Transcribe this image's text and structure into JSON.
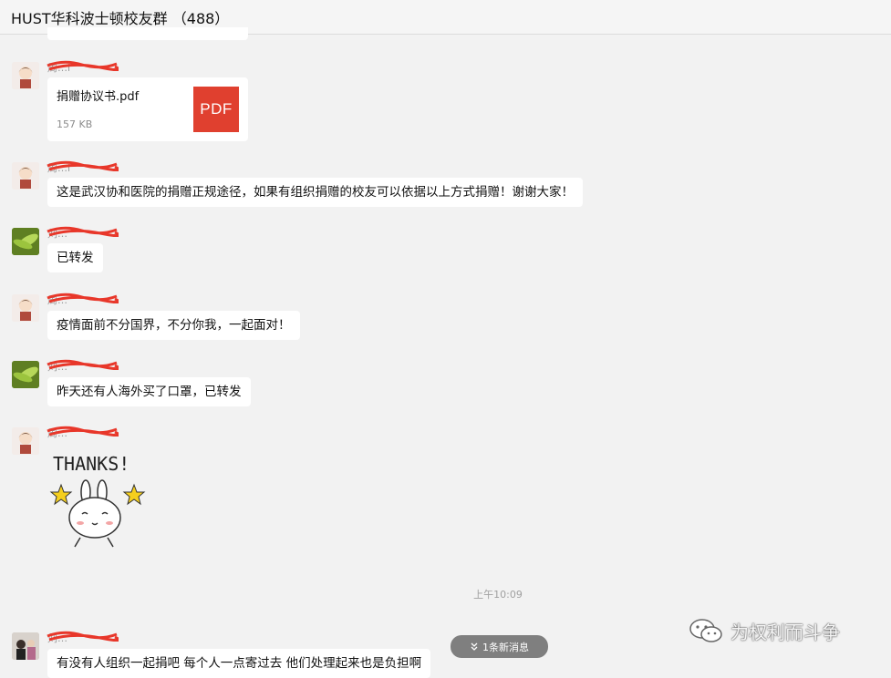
{
  "header": {
    "title": "HUST华科波士顿校友群 （488）"
  },
  "messages": [
    {
      "sender": "周…i",
      "file_name": "捐赠协议书.pdf",
      "file_size": "157 KB",
      "file_badge": "PDF"
    },
    {
      "sender": "周…i",
      "text": "这是武汉协和医院的捐赠正规途径，如果有组织捐赠的校友可以依据以上方式捐赠！谢谢大家！"
    },
    {
      "sender": "刘…",
      "text": "已转发"
    },
    {
      "sender": "周…",
      "text": "疫情面前不分国界，不分你我，一起面对！"
    },
    {
      "sender": "刘…",
      "text": "昨天还有人海外买了口罩，已转发"
    },
    {
      "sender": "周…",
      "sticker_text": "THANKS!"
    },
    {
      "sender": "刘…",
      "text": "有没有人组织一起捐吧 每个人一点寄过去 他们处理起来也是负担啊"
    }
  ],
  "time_divider": "上午10:09",
  "new_messages_button": "1条新消息",
  "watermark": "为权利而斗争",
  "colors": {
    "pdf_red": "#e0402f",
    "redaction_red": "#e8372a"
  }
}
